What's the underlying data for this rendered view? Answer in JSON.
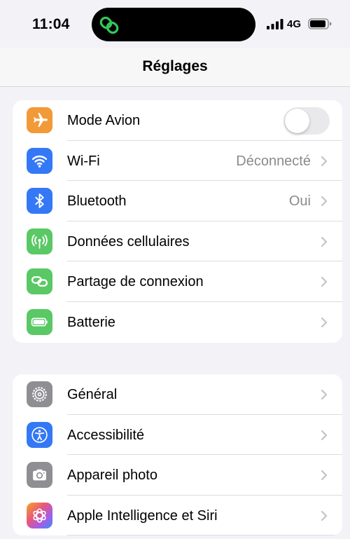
{
  "status_bar": {
    "time": "11:04",
    "network": "4G",
    "island_icon": "link-icon",
    "island_icon_color": "#34c759"
  },
  "nav": {
    "title": "Réglages"
  },
  "groups": [
    {
      "rows": [
        {
          "label": "Mode Avion",
          "icon": "airplane-icon",
          "color": "#f19a37",
          "toggle": true,
          "toggle_on": false
        },
        {
          "label": "Wi-Fi",
          "icon": "wifi-icon",
          "color": "#3478f6",
          "value": "Déconnecté"
        },
        {
          "label": "Bluetooth",
          "icon": "bluetooth-icon",
          "color": "#3478f6",
          "value": "Oui"
        },
        {
          "label": "Données cellulaires",
          "icon": "antenna-icon",
          "color": "#5ac864"
        },
        {
          "label": "Partage de connexion",
          "icon": "link-icon",
          "color": "#5ac864"
        },
        {
          "label": "Batterie",
          "icon": "battery-icon",
          "color": "#5ac864"
        }
      ]
    },
    {
      "rows": [
        {
          "label": "Général",
          "icon": "gear-icon",
          "color": "#8e8e93"
        },
        {
          "label": "Accessibilité",
          "icon": "accessibility-icon",
          "color": "#3478f6"
        },
        {
          "label": "Appareil photo",
          "icon": "camera-icon",
          "color": "#8e8e93"
        },
        {
          "label": "Apple Intelligence et Siri",
          "icon": "apple-intelligence-icon",
          "color": "#e86a8a"
        }
      ]
    }
  ]
}
